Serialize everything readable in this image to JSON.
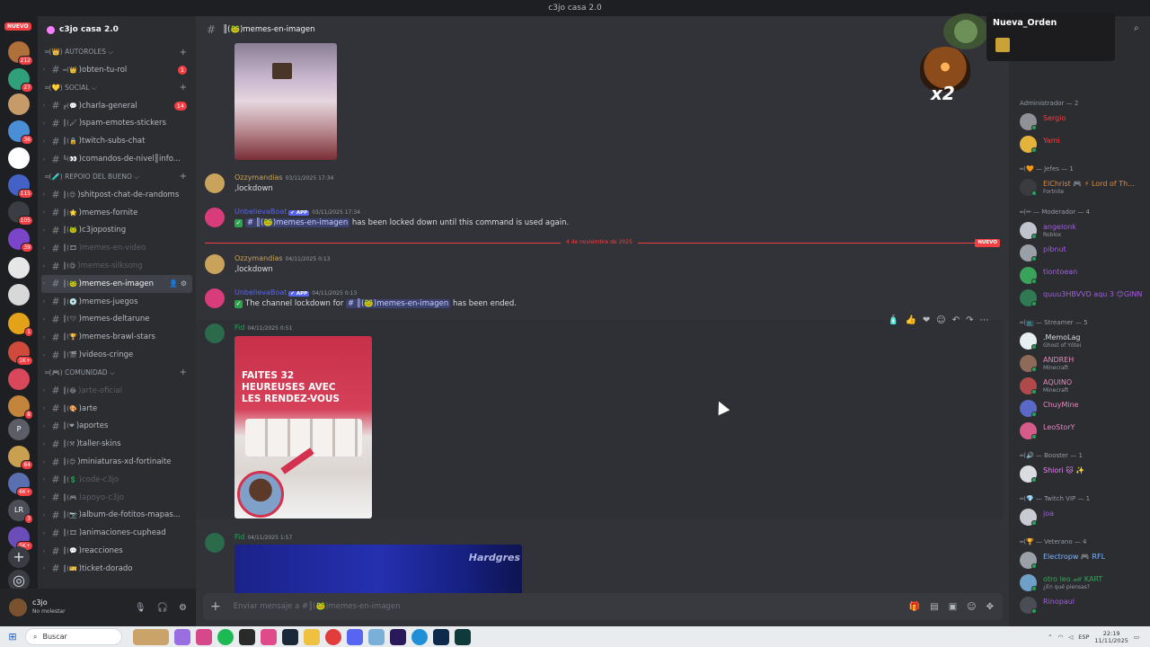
{
  "window": {
    "title": "c3jo casa 2.0"
  },
  "rail": {
    "nuevo": "NUEVO",
    "servers": [
      {
        "badge": "212",
        "color": "#b0703a"
      },
      {
        "badge": "27",
        "color": "#2fa07a"
      },
      {
        "badge": "",
        "color": "#c79a6a"
      },
      {
        "badge": "36",
        "color": "#4a8fd6"
      },
      {
        "badge": "",
        "color": "#ffffff"
      },
      {
        "badge": "115",
        "color": "#4462c5"
      },
      {
        "badge": "105",
        "color": "#3b3d45"
      },
      {
        "badge": "39",
        "color": "#7b45c9"
      },
      {
        "badge": "",
        "color": "#e6e6e6"
      },
      {
        "badge": "",
        "color": "#d8d8d8"
      },
      {
        "badge": "1",
        "color": "#e3a21a"
      },
      {
        "badge": "1K+",
        "color": "#cf4a3a"
      },
      {
        "badge": "",
        "color": "#d8475a"
      },
      {
        "badge": "8",
        "color": "#c2853b"
      },
      {
        "badge": "",
        "color": "#5b5e66",
        "label": "P"
      },
      {
        "badge": "84",
        "color": "#c8a050"
      },
      {
        "badge": "6K+",
        "color": "#5a6fb0"
      },
      {
        "badge": "3",
        "color": "#4b4e56",
        "label": "LR"
      },
      {
        "badge": "5K+",
        "color": "#6a4db8"
      }
    ],
    "add_icon": "+",
    "discover_icon": "◎"
  },
  "sidebar": {
    "server_name": "c3jo casa 2.0",
    "categories": [
      {
        "label": "═(👑) AUTOROLES ⌵",
        "channels": [
          {
            "pre": "═(👑",
            "name": ")obten-tu-rol",
            "badge": "1",
            "muted": false
          }
        ]
      },
      {
        "label": "═(💛) SOCIAL ⌵",
        "channels": [
          {
            "pre": "╔(💬",
            "name": ")charla-general",
            "badge": "14",
            "muted": false
          },
          {
            "pre": "║(🖌",
            "name": ")spam-emotes-stickers",
            "badge": "",
            "muted": false
          },
          {
            "pre": "║(🔒",
            "name": ")twitch-subs-chat",
            "badge": "",
            "muted": false
          },
          {
            "pre": "╚(👀",
            "name": ")comandos-de-nivel║info...",
            "badge": "",
            "muted": false
          }
        ]
      },
      {
        "label": "═(🧪) REPOIO DEL BUENO ⌵",
        "channels": [
          {
            "pre": "║(😊",
            "name": ")shitpost-chat-de-randoms",
            "badge": "",
            "muted": false
          },
          {
            "pre": "║(🌟",
            "name": ")memes-fornite",
            "badge": "",
            "muted": false
          },
          {
            "pre": "║(🐸",
            "name": ")c3joposting",
            "badge": "",
            "muted": false
          },
          {
            "pre": "║(🎞",
            "name": ")memes-en-video",
            "badge": "",
            "muted": true
          },
          {
            "pre": "║(😋",
            "name": ")memes-silksong",
            "badge": "",
            "muted": true
          },
          {
            "pre": "║(🐸",
            "name": ")memes-en-imagen",
            "badge": "",
            "muted": false,
            "active": true
          },
          {
            "pre": "║(💿",
            "name": ")memes-juegos",
            "badge": "",
            "muted": false
          },
          {
            "pre": "║(🖤",
            "name": ")memes-deltarune",
            "badge": "",
            "muted": false
          },
          {
            "pre": "║(🏆",
            "name": ")memes-brawl-stars",
            "badge": "",
            "muted": false
          },
          {
            "pre": "║(🎬",
            "name": ")videos-cringe",
            "badge": "",
            "muted": false
          }
        ]
      },
      {
        "label": "═(🎮) COMUNIDAD ⌵",
        "channels": [
          {
            "pre": "║(😂",
            "name": ")arte-oficial",
            "badge": "",
            "muted": true
          },
          {
            "pre": "║(🎨",
            "name": ")arte",
            "badge": "",
            "muted": false
          },
          {
            "pre": "║(❤",
            "name": ")aportes",
            "badge": "",
            "muted": false
          },
          {
            "pre": "║(⚒",
            "name": ")taller-skins",
            "badge": "",
            "muted": false
          },
          {
            "pre": "║(😊",
            "name": ")miniaturas-xd-fortinaite",
            "badge": "",
            "muted": false
          },
          {
            "pre": "║(💲",
            "name": ")code-c3jo",
            "badge": "",
            "muted": true
          },
          {
            "pre": "║(🎮",
            "name": ")apoyo-c3jo",
            "badge": "",
            "muted": true
          },
          {
            "pre": "║(📷",
            "name": ")album-de-fotitos-mapas...",
            "badge": "",
            "muted": false
          },
          {
            "pre": "║(🎞",
            "name": ")animaciones-cuphead",
            "badge": "",
            "muted": false
          },
          {
            "pre": "║(💬",
            "name": ")reacciones",
            "badge": "",
            "muted": false
          },
          {
            "pre": "║(🎫",
            "name": ")ticket-dorado",
            "badge": "",
            "muted": false
          }
        ]
      }
    ]
  },
  "user": {
    "name": "c3jo",
    "status": "No molestar"
  },
  "channel": {
    "name": "║(🐸)memes-en-imagen"
  },
  "messages": [
    {
      "author": "Ozzymandias",
      "color": "#c9a35b",
      "time": "03/11/2025 17:34",
      "text": ",lockdown",
      "app": false
    },
    {
      "author": "UnbelievaBoat",
      "color": "#5865f2",
      "time": "03/11/2025 17:34",
      "app": true,
      "app_label": "✔ APP",
      "pre": "",
      "mention": "# ║(🐸)memes-en-imagen",
      "post": " has been locked down until this command is used again."
    },
    {
      "author": "Ozzymandias",
      "color": "#c9a35b",
      "time": "04/11/2025 0:13",
      "text": ",lockdown",
      "app": false
    },
    {
      "author": "UnbelievaBoat",
      "color": "#5865f2",
      "time": "04/11/2025 0:13",
      "app": true,
      "app_label": "✔ APP",
      "pre": "The channel lockdown for ",
      "mention": "# ║(🐸)memes-en-imagen",
      "post": " has been ended."
    },
    {
      "author": "Fid",
      "color": "#23a55a",
      "time": "04/11/2025 0:51"
    },
    {
      "author": "Fid",
      "color": "#23a55a",
      "time": "04/11/2025 1:57"
    }
  ],
  "divider": {
    "date": "4 de noviembre de 2025",
    "new_label": "NUEVO"
  },
  "poster": {
    "text": "FAITES 32 HEUREUSES AVEC LES RENDEZ-VOUS"
  },
  "image3": {
    "brand": "Hardgres"
  },
  "composer": {
    "placeholder": "Enviar mensaje a #║(🐸)memes-en-imagen"
  },
  "overlay": {
    "streamer": "Nueva_Orden",
    "multiplier": "x2"
  },
  "members": {
    "groups": [
      {
        "label": "Administrador — 2",
        "members": [
          {
            "name": "Sergio",
            "color": "#f23f43",
            "sub": "",
            "avatar": "#8e9297"
          },
          {
            "name": "Yami",
            "color": "#f23f43",
            "sub": "",
            "avatar": "#e3b33b"
          }
        ]
      },
      {
        "label": "═(🧡 — Jefes — 1",
        "members": [
          {
            "name": "ElChrist 🎮 ⚡ Lord of Th...",
            "color": "#e08a3c",
            "sub": "Fortnite",
            "avatar": "#3a3c40"
          }
        ]
      },
      {
        "label": "═(✏ — Moderador — 4",
        "members": [
          {
            "name": "angelonk",
            "color": "#a35ee0",
            "sub": "Roblox",
            "avatar": "#c0c4cc"
          },
          {
            "name": "pibnut",
            "color": "#a35ee0",
            "sub": "",
            "avatar": "#9aa0a8"
          },
          {
            "name": "tiontoean",
            "color": "#a35ee0",
            "sub": "",
            "avatar": "#3aa35a"
          },
          {
            "name": "quuu3HBVVD aqu 3 😊GINN",
            "color": "#a35ee0",
            "sub": "",
            "avatar": "#2f7a52"
          }
        ]
      },
      {
        "label": "═(📺 — Streamer — 5",
        "members": [
          {
            "name": ".MemoLag",
            "color": "#d7dde3",
            "sub": "Ghost of Yōtei",
            "avatar": "#e6f0f0"
          },
          {
            "name": "ANDREH",
            "color": "#e986c0",
            "sub": "Minecraft",
            "avatar": "#8e6a58"
          },
          {
            "name": "AQUINO",
            "color": "#e986c0",
            "sub": "Minecraft",
            "avatar": "#b04a4a"
          },
          {
            "name": "ChuyMine",
            "color": "#e986c0",
            "sub": "",
            "avatar": "#5a69c8"
          },
          {
            "name": "LeoStorY",
            "color": "#e986c0",
            "sub": "",
            "avatar": "#d65b8a"
          }
        ]
      },
      {
        "label": "═(🔊 — Booster — 1",
        "members": [
          {
            "name": "Shiori 🐱 ✨",
            "color": "#f47fff",
            "sub": "",
            "avatar": "#d9dde2"
          }
        ]
      },
      {
        "label": "═(💎 — Twitch VIP — 1",
        "members": [
          {
            "name": "joa",
            "color": "#a35ee0",
            "sub": "",
            "avatar": "#c8ccd2"
          }
        ]
      },
      {
        "label": "═(🏆 — Veterano — 4",
        "members": [
          {
            "name": "Electropw 🎮 RFL",
            "color": "#7fb6ff",
            "sub": "",
            "avatar": "#9aa0a8"
          },
          {
            "name": "otro leo 🏎 KART",
            "color": "#3aa35a",
            "sub": "¿En qué piensas?",
            "avatar": "#6fa0c8"
          },
          {
            "name": "Rinopaul",
            "color": "#a35ee0",
            "sub": "",
            "avatar": "#4a4d55"
          }
        ]
      }
    ]
  },
  "taskbar": {
    "search": "Buscar",
    "lang": "ESP",
    "time": "22:19",
    "date": "11/11/2025"
  }
}
